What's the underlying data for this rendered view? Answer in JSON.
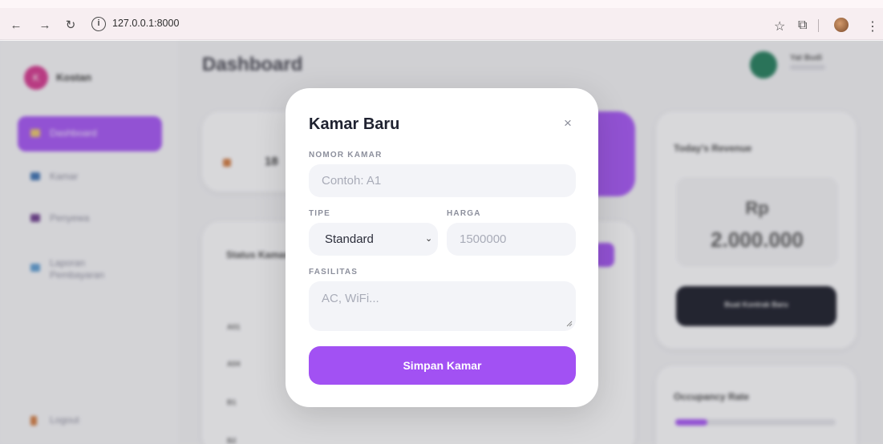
{
  "browser": {
    "url": "127.0.0.1:8000",
    "back_icon": "arrow-left-icon",
    "forward_icon": "arrow-right-icon",
    "reload_icon": "reload-icon",
    "info_icon": "info-icon",
    "star_icon": "star-icon",
    "extensions_icon": "puzzle-icon",
    "menu_icon": "more-vert-icon"
  },
  "app": {
    "brand": "Kostan",
    "page_title": "Dashboard",
    "sidebar": [
      "Dashboard",
      "Kamar",
      "Penyewa",
      "Laporan Pembayaran"
    ],
    "logout": "Logout",
    "user_name": "Yat Budi",
    "stat_value": "18",
    "status_title": "Status Kamar",
    "rows": [
      "A01",
      "A04",
      "B1",
      "B2"
    ],
    "revenue_title": "Today's Revenue",
    "revenue_currency": "Rp",
    "revenue_amount": "2.000.000",
    "contract_button": "Buat Kontrak Baru",
    "occupancy_title": "Occupancy Rate"
  },
  "modal": {
    "title": "Kamar Baru",
    "close_glyph": "×",
    "room_label": "NOMOR KAMAR",
    "room_placeholder": "Contoh: A1",
    "type_label": "TIPE",
    "type_selected": "Standard",
    "price_label": "HARGA",
    "price_placeholder": "1500000",
    "facilities_label": "FASILITAS",
    "facilities_placeholder": "AC, WiFi...",
    "submit_label": "Simpan Kamar"
  }
}
